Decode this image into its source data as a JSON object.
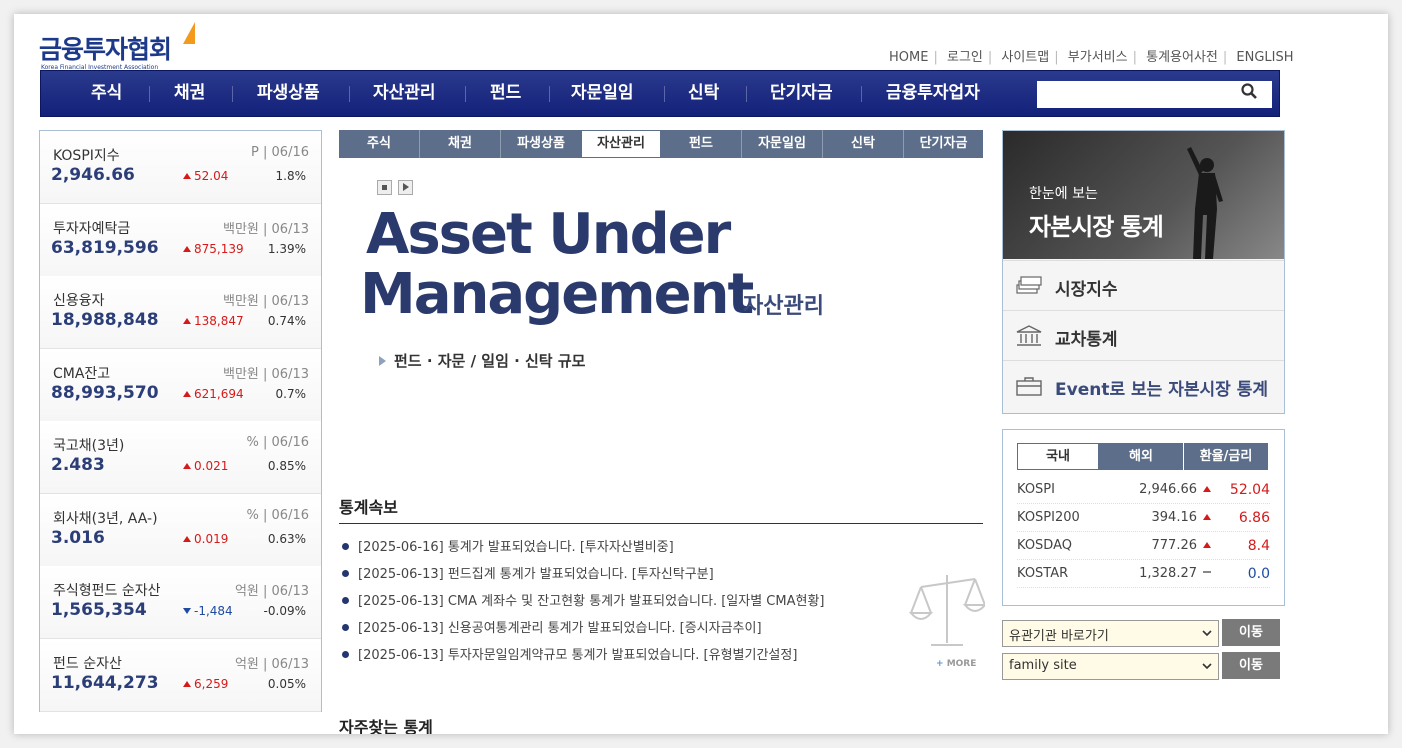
{
  "header": {
    "logo_kr": "금융투자협회",
    "logo_en": "Korea Financial Investment Association",
    "util": [
      "HOME",
      "로그인",
      "사이트맵",
      "부가서비스",
      "통계용어사전",
      "ENGLISH"
    ]
  },
  "gnb": [
    "주식",
    "채권",
    "파생상품",
    "자산관리",
    "펀드",
    "자문일임",
    "신탁",
    "단기자금",
    "금융투자업자"
  ],
  "search": {
    "placeholder": ""
  },
  "indices": [
    {
      "name": "KOSPI지수",
      "unit": "P | 06/16",
      "value": "2,946.66",
      "change": "52.04",
      "dir": "up",
      "pct": "1.8%"
    },
    {
      "name": "투자자예탁금",
      "unit": "백만원 | 06/13",
      "value": "63,819,596",
      "change": "875,139",
      "dir": "up",
      "pct": "1.39%"
    },
    {
      "name": "신용융자",
      "unit": "백만원 | 06/13",
      "value": "18,988,848",
      "change": "138,847",
      "dir": "up",
      "pct": "0.74%"
    },
    {
      "name": "CMA잔고",
      "unit": "백만원 | 06/13",
      "value": "88,993,570",
      "change": "621,694",
      "dir": "up",
      "pct": "0.7%"
    },
    {
      "name": "국고채(3년)",
      "unit": "% | 06/16",
      "value": "2.483",
      "change": "0.021",
      "dir": "up",
      "pct": "0.85%"
    },
    {
      "name": "회사채(3년, AA-)",
      "unit": "% | 06/16",
      "value": "3.016",
      "change": "0.019",
      "dir": "up",
      "pct": "0.63%"
    },
    {
      "name": "주식형펀드 순자산",
      "unit": "억원 | 06/13",
      "value": "1,565,354",
      "change": "-1,484",
      "dir": "down",
      "pct": "-0.09%"
    },
    {
      "name": "펀드 순자산",
      "unit": "억원 | 06/13",
      "value": "11,644,273",
      "change": "6,259",
      "dir": "up",
      "pct": "0.05%"
    }
  ],
  "subtabs": [
    "주식",
    "채권",
    "파생상품",
    "자산관리",
    "펀드",
    "자문일임",
    "신탁",
    "단기자금"
  ],
  "hero": {
    "line1": "Asset Under",
    "line2": "Management",
    "kr": "자산관리",
    "sub": "펀드 · 자문 / 일임 · 신탁 규모"
  },
  "news": {
    "title": "통계속보",
    "items": [
      "[2025-06-16] 통계가 발표되었습니다. [투자자산별비중]",
      "[2025-06-13] 펀드집계 통계가 발표되었습니다. [투자신탁구분]",
      "[2025-06-13] CMA 계좌수 및 잔고현황 통계가 발표되었습니다. [일자별 CMA현황]",
      "[2025-06-13] 신용공여통계관리 통계가 발표되었습니다. [증시자금추이]",
      "[2025-06-13] 투자자문일임계약규모 통계가 발표되었습니다. [유형별기간설정]"
    ],
    "more": "MORE"
  },
  "frequent": {
    "title": "자주찾는 통계"
  },
  "banner": {
    "small": "한눈에 보는",
    "big": "자본시장 통계",
    "menu": [
      "시장지수",
      "교차통계",
      "Event로 보는 자본시장 통계"
    ]
  },
  "market": {
    "tabs": [
      "국내",
      "해외",
      "환율/금리"
    ],
    "rows": [
      {
        "name": "KOSPI",
        "value": "2,946.66",
        "change": "52.04",
        "dir": "up"
      },
      {
        "name": "KOSPI200",
        "value": "394.16",
        "change": "6.86",
        "dir": "up"
      },
      {
        "name": "KOSDAQ",
        "value": "777.26",
        "change": "8.4",
        "dir": "up"
      },
      {
        "name": "KOSTAR",
        "value": "1,328.27",
        "change": "0.0",
        "dir": "flat"
      }
    ]
  },
  "quick": {
    "select1": "유관기관 바로가기",
    "select2": "family site",
    "go": "이동"
  },
  "colors": {
    "navy": "#1d3a8a",
    "up": "#d61a1a",
    "down": "#1f4aa0",
    "tab_bg": "#5c6e8a"
  }
}
